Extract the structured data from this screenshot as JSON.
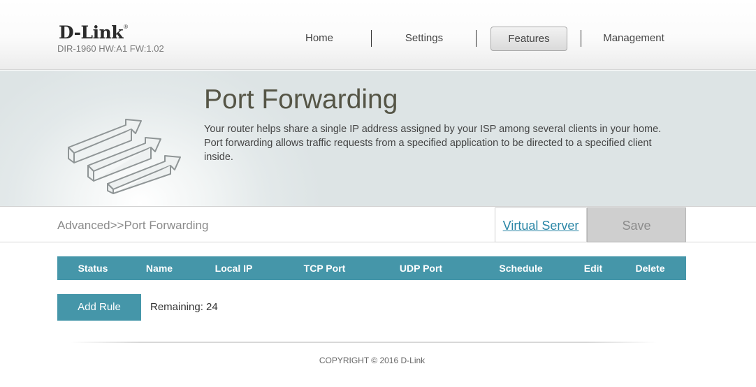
{
  "header": {
    "logo": "D-Link",
    "logo_mark": "®",
    "model": "DIR-1960 HW:A1 FW:1.02",
    "nav": {
      "home": "Home",
      "settings": "Settings",
      "features": "Features",
      "management": "Management"
    },
    "active_tab": "Features"
  },
  "banner": {
    "title": "Port Forwarding",
    "description": "Your router helps share a single IP address assigned by your ISP among several clients in your home. Port forwarding allows traffic requests from a specified application to be directed to a specified client inside.",
    "icon": "port-forwarding-arrows-icon"
  },
  "subbar": {
    "breadcrumb": "Advanced>>Port Forwarding",
    "virtual_server_link": "Virtual Server",
    "save_label": "Save"
  },
  "table": {
    "columns": [
      "Status",
      "Name",
      "Local IP",
      "TCP Port",
      "UDP Port",
      "Schedule",
      "Edit",
      "Delete"
    ],
    "rows": []
  },
  "actions": {
    "add_rule_label": "Add Rule",
    "remaining": "Remaining: 24"
  },
  "footer": {
    "copyright": "COPYRIGHT © 2016 D-Link"
  },
  "colors": {
    "accent": "#4596a9",
    "link": "#2a86a6",
    "save_bg": "#cfcfcf"
  }
}
